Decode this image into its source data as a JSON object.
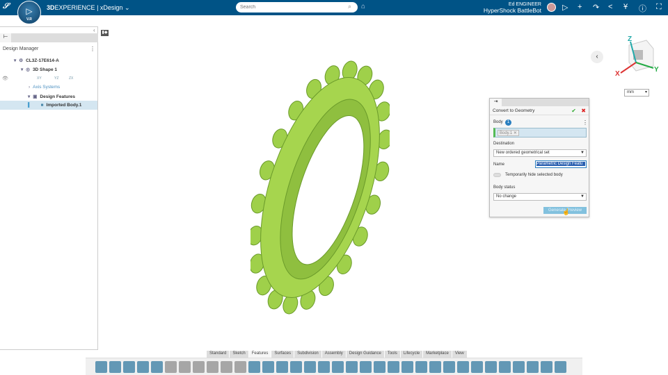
{
  "topbar": {
    "brand_bold": "3D",
    "brand_rest": "EXPERIENCE",
    "separator": "|",
    "app": "xDesign",
    "search_placeholder": "Search",
    "user_name": "Ed ENGINEER",
    "workspace": "HyperShock BattleBot",
    "compass_label": "V.R"
  },
  "panel": {
    "title": "Design Manager",
    "tree": [
      {
        "label": "CL3Z-17E614-A",
        "icon": "part-icon"
      },
      {
        "label": "3D Shape 1",
        "icon": "shape-icon"
      },
      {
        "label": "Axis Systems",
        "icon": "chevron-right-icon"
      },
      {
        "label": "Design Features",
        "icon": "features-icon"
      },
      {
        "label": "Imported Body.1",
        "icon": "body-icon"
      }
    ],
    "planes": [
      "XY",
      "YZ",
      "ZX"
    ]
  },
  "viewport": {
    "unit": "mm",
    "axes": [
      "X",
      "Y",
      "Z"
    ],
    "model_color": "#9fd04a"
  },
  "dialog": {
    "title": "Convert to Geometry",
    "body_label": "Body",
    "body_count": "1",
    "body_chip": "Body.1",
    "destination_label": "Destination",
    "destination_value": "New ordered geometrical set",
    "name_label": "Name",
    "name_value": "Parametric Design Featu",
    "hide_label": "Temporarily hide selected body",
    "status_label": "Body status",
    "status_value": "No change",
    "preview_button": "Generate Preview"
  },
  "tabs": [
    "Standard",
    "Sketch",
    "Features",
    "Surfaces",
    "Subdivision",
    "Assembly",
    "Design Guidance",
    "Tools",
    "Lifecycle",
    "Marketplace",
    "View"
  ],
  "active_tab": "Features",
  "colors": {
    "topbar": "#005386",
    "accent": "#82c1de",
    "selection": "#d4e6f1"
  }
}
